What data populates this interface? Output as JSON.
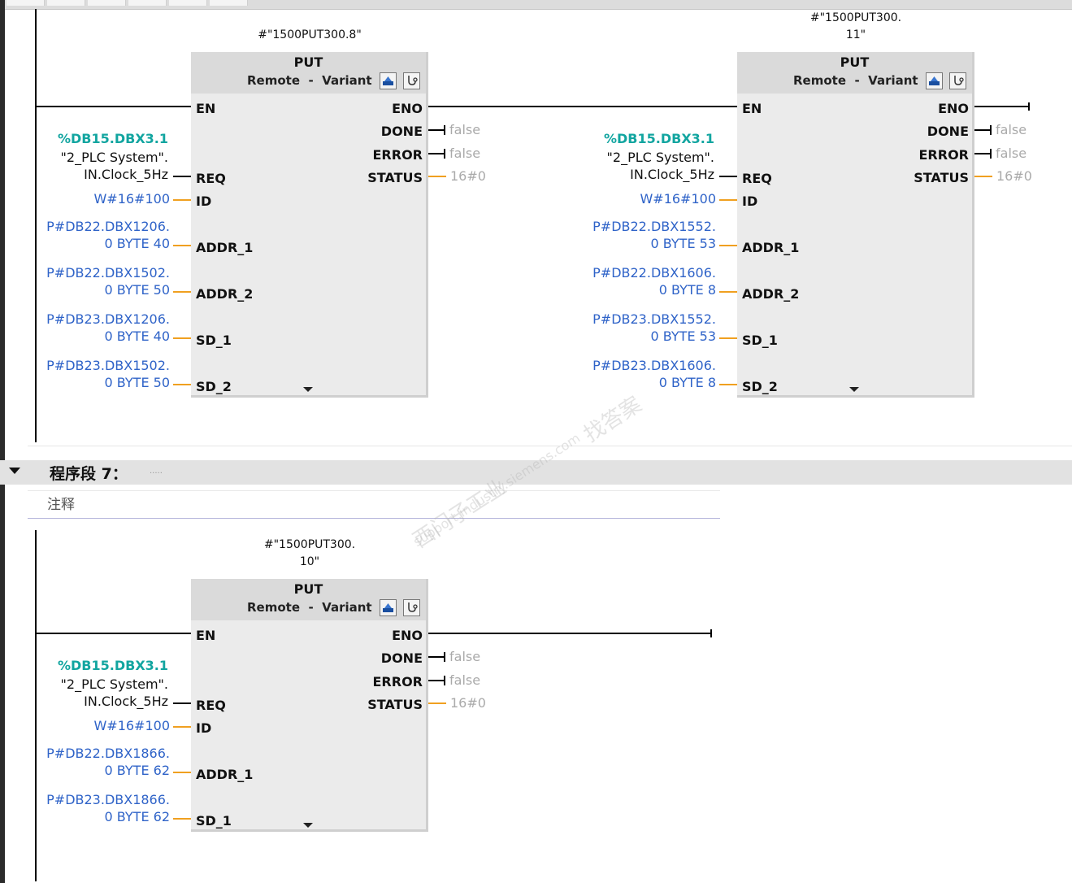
{
  "network6": {
    "blocks": [
      {
        "instance_line1": "#\"1500PUT300.8\"",
        "instance_line2": "",
        "type": "PUT",
        "param_remote": "Remote",
        "param_sep": "-",
        "param_variant": "Variant",
        "pins_in": [
          "EN",
          "REQ",
          "ID",
          "ADDR_1",
          "ADDR_2",
          "SD_1",
          "SD_2"
        ],
        "pins_out": [
          "ENO",
          "DONE",
          "ERROR",
          "STATUS"
        ],
        "done_value": "false",
        "error_value": "false",
        "status_value": "16#0",
        "req_address": "%DB15.DBX3.1",
        "req_symbol_line1": "\"2_PLC System\".",
        "req_symbol_line2": "IN.Clock_5Hz",
        "id_value": "W#16#100",
        "addr1_line1": "P#DB22.DBX1206.",
        "addr1_line2": "0 BYTE 40",
        "addr2_line1": "P#DB22.DBX1502.",
        "addr2_line2": "0 BYTE 50",
        "sd1_line1": "P#DB23.DBX1206.",
        "sd1_line2": "0 BYTE 40",
        "sd2_line1": "P#DB23.DBX1502.",
        "sd2_line2": "0 BYTE 50"
      },
      {
        "instance_line1": "#\"1500PUT300.",
        "instance_line2": "11\"",
        "type": "PUT",
        "param_remote": "Remote",
        "param_sep": "-",
        "param_variant": "Variant",
        "pins_in": [
          "EN",
          "REQ",
          "ID",
          "ADDR_1",
          "ADDR_2",
          "SD_1",
          "SD_2"
        ],
        "pins_out": [
          "ENO",
          "DONE",
          "ERROR",
          "STATUS"
        ],
        "done_value": "false",
        "error_value": "false",
        "status_value": "16#0",
        "req_address": "%DB15.DBX3.1",
        "req_symbol_line1": "\"2_PLC System\".",
        "req_symbol_line2": "IN.Clock_5Hz",
        "id_value": "W#16#100",
        "addr1_line1": "P#DB22.DBX1552.",
        "addr1_line2": "0 BYTE 53",
        "addr2_line1": "P#DB22.DBX1606.",
        "addr2_line2": "0 BYTE 8",
        "sd1_line1": "P#DB23.DBX1552.",
        "sd1_line2": "0 BYTE 53",
        "sd2_line1": "P#DB23.DBX1606.",
        "sd2_line2": "0 BYTE 8"
      }
    ]
  },
  "network7": {
    "title": "程序段 7：",
    "title_dots": ".....",
    "comment": "注释",
    "block": {
      "instance_line1": "#\"1500PUT300.",
      "instance_line2": "10\"",
      "type": "PUT",
      "param_remote": "Remote",
      "param_sep": "-",
      "param_variant": "Variant",
      "pins_in": [
        "EN",
        "REQ",
        "ID",
        "ADDR_1",
        "SD_1"
      ],
      "pins_out": [
        "ENO",
        "DONE",
        "ERROR",
        "STATUS"
      ],
      "done_value": "false",
      "error_value": "false",
      "status_value": "16#0",
      "req_address": "%DB15.DBX3.1",
      "req_symbol_line1": "\"2_PLC System\".",
      "req_symbol_line2": "IN.Clock_5Hz",
      "id_value": "W#16#100",
      "addr1_line1": "P#DB22.DBX1866.",
      "addr1_line2": "0 BYTE 62",
      "sd1_line1": "P#DB23.DBX1866.",
      "sd1_line2": "0 BYTE 62"
    }
  },
  "watermark": {
    "line1": "西门子工业",
    "line2": "support.industry.siemens.com",
    "line3": "找答案"
  },
  "icons": {
    "collapse": "triangle-down-icon",
    "block_download": "download-icon",
    "block_diagnostics": "diagnostics-icon",
    "expand_params": "expand-down-icon"
  },
  "colors": {
    "operand": "#2f63c8",
    "address": "#12a5a0",
    "stub": "#f0a020",
    "value": "#aaaaaa"
  }
}
